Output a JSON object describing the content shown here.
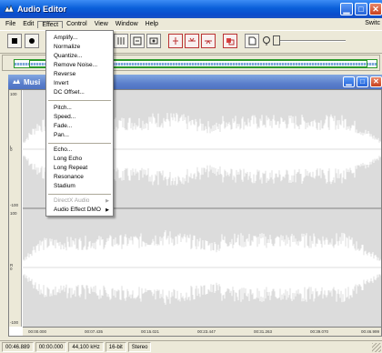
{
  "window": {
    "title": "Audio Editor"
  },
  "menubar": {
    "items": [
      "File",
      "Edit",
      "Effect",
      "Control",
      "View",
      "Window",
      "Help"
    ],
    "right_label": "Switc"
  },
  "child_window": {
    "title": "Musi"
  },
  "effect_menu": {
    "items": [
      {
        "label": "Amplify...",
        "enabled": true
      },
      {
        "label": "Normalize",
        "enabled": true
      },
      {
        "label": "Quantize...",
        "enabled": true
      },
      {
        "label": "Remove Noise...",
        "enabled": true
      },
      {
        "label": "Reverse",
        "enabled": true
      },
      {
        "label": "Invert",
        "enabled": true
      },
      {
        "label": "DC Offset...",
        "enabled": true
      },
      {
        "label": "Pitch...",
        "enabled": true
      },
      {
        "label": "Speed...",
        "enabled": true
      },
      {
        "label": "Fade...",
        "enabled": true
      },
      {
        "label": "Pan...",
        "enabled": true
      },
      {
        "label": "Echo...",
        "enabled": true
      },
      {
        "label": "Long Echo",
        "enabled": true
      },
      {
        "label": "Long Repeat",
        "enabled": true
      },
      {
        "label": "Resonance",
        "enabled": true
      },
      {
        "label": "Stadium",
        "enabled": true
      },
      {
        "label": "DirectX Audio",
        "enabled": false,
        "submenu": true
      },
      {
        "label": "Audio Effect DMO",
        "enabled": true,
        "submenu": true
      }
    ]
  },
  "waveform": {
    "channels": [
      "L",
      "R"
    ],
    "ruler_labels": [
      "100",
      "0",
      "-100",
      "100",
      "0",
      "-100"
    ],
    "time_labels": [
      "00:00.000",
      "00:07.435",
      "00:15.021",
      "00:23.447",
      "00:31.263",
      "00:39.070",
      "00:46.999"
    ],
    "color": "#ffffff",
    "background": "#dcdcdc"
  },
  "statusbar": {
    "cells": [
      "00:46.889",
      "00:00.000",
      "44,100 kHz",
      "16-bit",
      "Stereo"
    ]
  },
  "colors": {
    "title_bar": "#0a5fd9",
    "child_title_bar": "#5b7fcc",
    "close_button": "#c8401c"
  }
}
